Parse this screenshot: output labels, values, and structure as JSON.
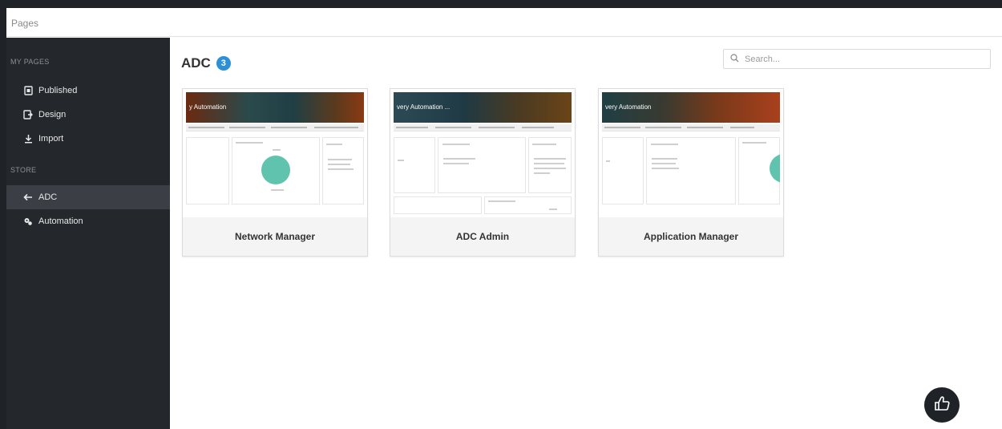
{
  "topbar": {
    "title": "Pages"
  },
  "sidebar": {
    "sections": [
      {
        "label": "MY PAGES"
      },
      {
        "label": "STORE"
      }
    ],
    "items": [
      {
        "label": "Published",
        "icon": "published-icon"
      },
      {
        "label": "Design",
        "icon": "design-icon"
      },
      {
        "label": "Import",
        "icon": "import-icon"
      },
      {
        "label": "ADC",
        "icon": "adc-icon",
        "active": true
      },
      {
        "label": "Automation",
        "icon": "automation-icon"
      }
    ]
  },
  "main": {
    "heading": "ADC",
    "count": "3",
    "search": {
      "placeholder": "Search..."
    },
    "cards": [
      {
        "title": "Network Manager",
        "banner": "y Automation"
      },
      {
        "title": "ADC Admin",
        "banner": "very Automation ..."
      },
      {
        "title": "Application Manager",
        "banner": "very Automation"
      }
    ]
  },
  "colors": {
    "sidebar": "#24272b",
    "active": "#3b3f45",
    "badge": "#2d8fd6",
    "chart": "#5fc3ad"
  },
  "feedback": {
    "icon": "thumbs-up-icon"
  }
}
